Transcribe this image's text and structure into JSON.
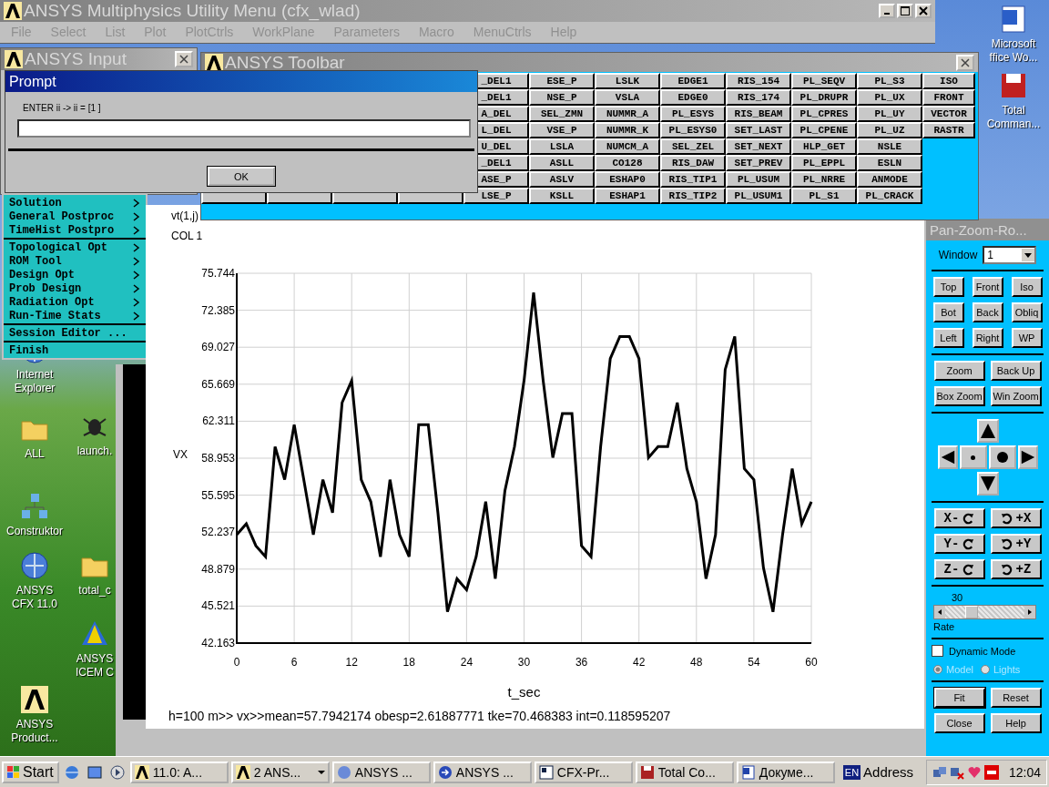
{
  "utility_window": {
    "title": "ANSYS Multiphysics Utility Menu (cfx_wlad)",
    "menu": [
      {
        "label": "File",
        "disabled": true
      },
      {
        "label": "Select",
        "disabled": true
      },
      {
        "label": "List",
        "disabled": true
      },
      {
        "label": "Plot",
        "disabled": true
      },
      {
        "label": "PlotCtrls",
        "disabled": true
      },
      {
        "label": "WorkPlane",
        "disabled": true
      },
      {
        "label": "Parameters",
        "disabled": true
      },
      {
        "label": "Macro",
        "disabled": true
      },
      {
        "label": "MenuCtrls",
        "disabled": true
      },
      {
        "label": "Help",
        "disabled": true
      }
    ]
  },
  "input_window": {
    "title": "ANSYS Input"
  },
  "prompt": {
    "title": "Prompt",
    "label": "ENTER ii -> ii = [1 ]",
    "button": "OK"
  },
  "toolbar": {
    "title": "ANSYS Toolbar",
    "rows": [
      [
        "_DEL1",
        "ESE_P",
        "LSLK",
        "EDGE1",
        "RIS_154",
        "PL_SEQV",
        "PL_S3",
        "ISO"
      ],
      [
        "_DEL1",
        "NSE_P",
        "VSLA",
        "EDGE0",
        "RIS_174",
        "PL_DRUPR",
        "PL_UX",
        "FRONT"
      ],
      [
        "A_DEL",
        "SEL_ZMN",
        "NUMMR_A",
        "PL_ESYS",
        "RIS_BEAM",
        "PL_CPRES",
        "PL_UY",
        "VECTOR"
      ],
      [
        "L_DEL",
        "VSE_P",
        "NUMMR_K",
        "PL_ESYS0",
        "SET_LAST",
        "PL_CPENE",
        "PL_UZ",
        "RASTR"
      ],
      [
        "U_DEL",
        "LSLA",
        "NUMCM_A",
        "SEL_ZEL",
        "SET_NEXT",
        "HLP_GET",
        "NSLE"
      ],
      [
        "_DEL1",
        "ASLL",
        "CO128",
        "RIS_DAW",
        "SET_PREV",
        "PL_EPPL",
        "ESLN"
      ],
      [
        "ASE_P",
        "ASLV",
        "ESHAP0",
        "RIS_TIP1",
        "PL_USUM",
        "PL_NRRE",
        "ANMODE"
      ],
      [
        "LSE_P",
        "KSLL",
        "ESHAP1",
        "RIS_TIP2",
        "PL_USUM1",
        "PL_S1",
        "PL_CRACK"
      ]
    ]
  },
  "main_menu": {
    "groups": [
      [
        {
          "label": "Solution",
          "submenu": true
        },
        {
          "label": "General Postproc",
          "submenu": true
        },
        {
          "label": "TimeHist Postpro",
          "submenu": true
        }
      ],
      [
        {
          "label": "Topological Opt",
          "submenu": true
        },
        {
          "label": "ROM Tool",
          "submenu": true
        },
        {
          "label": "Design Opt",
          "submenu": true
        },
        {
          "label": "Prob Design",
          "submenu": true
        },
        {
          "label": "Radiation Opt",
          "submenu": true
        },
        {
          "label": "Run-Time Stats",
          "submenu": true
        }
      ],
      [
        {
          "label": "Session Editor ...",
          "submenu": false
        }
      ],
      [
        {
          "label": "Finish",
          "submenu": false
        }
      ]
    ]
  },
  "graphics": {
    "chart_data": {
      "type": "line",
      "title": "vt(1,j)",
      "xlabel": "t_sec",
      "ylabel": "VX",
      "x": [
        0,
        1,
        2,
        3,
        4,
        5,
        6,
        7,
        8,
        9,
        10,
        11,
        12,
        13,
        14,
        15,
        16,
        17,
        18,
        19,
        20,
        21,
        22,
        23,
        24,
        25,
        26,
        27,
        28,
        29,
        30,
        31,
        32,
        33,
        34,
        35,
        36,
        37,
        38,
        39,
        40,
        41,
        42,
        43,
        44,
        45,
        46,
        47,
        48,
        49,
        50,
        51,
        52,
        53,
        54,
        55,
        56,
        57,
        58,
        59,
        60
      ],
      "series": [
        {
          "name": "COL 1",
          "color": "#000000",
          "values": [
            52,
            53,
            51,
            50,
            60,
            57,
            62,
            57,
            52,
            57,
            54,
            64,
            66,
            57,
            55,
            50,
            57,
            52,
            50,
            62,
            62,
            54,
            45,
            48,
            47,
            50,
            55,
            48,
            56,
            60,
            66,
            74,
            66,
            59,
            63,
            63,
            51,
            50,
            60,
            68,
            70,
            70,
            68,
            59,
            60,
            60,
            64,
            58,
            55,
            48,
            52,
            67,
            70,
            58,
            57,
            49,
            45,
            52,
            58,
            53,
            55
          ]
        }
      ],
      "grid": true,
      "xlim": [
        0,
        60
      ],
      "ylim": [
        42.163,
        75.744
      ],
      "xticks": [
        0,
        6,
        12,
        18,
        24,
        30,
        36,
        42,
        48,
        54,
        60
      ],
      "yticks": [
        42.163,
        45.521,
        48.879,
        52.237,
        55.595,
        58.953,
        62.311,
        65.669,
        69.027,
        72.385,
        75.744
      ]
    },
    "footer": "h=100 m>> vx>>mean=57.7942174  obesp=2.61887771 tke=70.468383 int=0.118595207"
  },
  "pan_zoom": {
    "title": "Pan-Zoom-Ro...",
    "window_label": "Window",
    "window_value": "1",
    "views": [
      "Top",
      "Front",
      "Iso",
      "Bot",
      "Back",
      "Obliq",
      "Left",
      "Right",
      "WP"
    ],
    "zoom_buttons": [
      "Zoom",
      "Back Up",
      "Box Zoom",
      "Win Zoom"
    ],
    "rotate_buttons": [
      {
        "label": "X-",
        "kind": "minus"
      },
      {
        "label": "+X",
        "kind": "plus"
      },
      {
        "label": "Y-",
        "kind": "minus"
      },
      {
        "label": "+Y",
        "kind": "plus"
      },
      {
        "label": "Z-",
        "kind": "minus"
      },
      {
        "label": "+Z",
        "kind": "plus"
      }
    ],
    "rate": {
      "value": "30",
      "label": "Rate",
      "level": 0.3
    },
    "dynamic_mode": {
      "label": "Dynamic Mode",
      "checked": false
    },
    "mode_options": [
      {
        "label": "Model",
        "selected": true,
        "disabled": true
      },
      {
        "label": "Lights",
        "selected": false,
        "disabled": true
      }
    ],
    "bottom_buttons": [
      "Fit",
      "Reset",
      "Close",
      "Help"
    ]
  },
  "desktop_icons": [
    {
      "label": "Internet\nExplorer",
      "kind": "browser"
    },
    {
      "label": "ALL",
      "kind": "folder"
    },
    {
      "label": "launch.",
      "kind": "bug"
    },
    {
      "label": "Construktor",
      "kind": "network"
    },
    {
      "label": "ANSYS\nCFX 11.0",
      "kind": "cfx"
    },
    {
      "label": "total_c",
      "kind": "folder"
    },
    {
      "label": "ANSYS\nICEM C",
      "kind": "icem"
    },
    {
      "label": "ANSYS\nProduct...",
      "kind": "ansys"
    },
    {
      "label": "Microsoft\nffice Wo...",
      "kind": "word"
    },
    {
      "label": "Total\nComman...",
      "kind": "disk"
    }
  ],
  "taskbar": {
    "start": "Start",
    "tasks": [
      {
        "label": "11.0: A...",
        "kind": "ansys",
        "menu": false
      },
      {
        "label": "2 ANS...",
        "kind": "ansys",
        "menu": true
      },
      {
        "label": "ANSYS ...",
        "kind": "globe",
        "menu": false
      },
      {
        "label": "ANSYS ...",
        "kind": "arrow",
        "menu": false
      },
      {
        "label": "CFX-Pr...",
        "kind": "window",
        "menu": false
      },
      {
        "label": "Total Co...",
        "kind": "disk",
        "menu": false
      },
      {
        "label": "Докуме...",
        "kind": "word",
        "menu": false
      }
    ],
    "language": "EN",
    "address": "Address",
    "clock": "12:04"
  }
}
